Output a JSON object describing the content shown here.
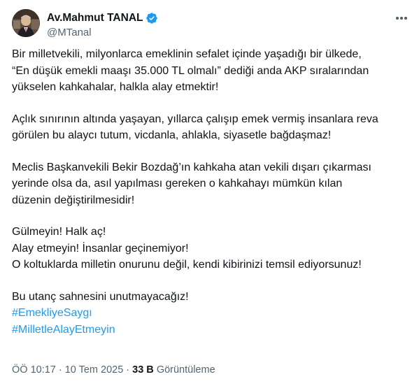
{
  "author": {
    "display_name": "Av.Mahmut TANAL",
    "handle": "@MTanal",
    "verified": true,
    "verified_color": "#1d9bf0"
  },
  "tweet": {
    "paragraphs": [
      [
        "Bir milletvekili, milyonlarca emeklinin sefalet içinde yaşadığı bir ülkede,",
        "“En düşük emekli maaşı 35.000 TL olmalı” dediği anda AKP sıralarından",
        "yükselen kahkahalar, halkla alay etmektir!"
      ],
      [
        "Açlık sınırının altında yaşayan, yıllarca çalışıp emek vermiş insanlara reva",
        "görülen bu alaycı tutum, vicdanla, ahlakla, siyasetle bağdaşmaz!"
      ],
      [
        "Meclis Başkanvekili Bekir Bozdağ’ın kahkaha atan vekili dışarı çıkarması",
        "yerinde olsa da, asıl yapılması gereken o kahkahayı mümkün kılan",
        "düzenin değiştirilmesidir!"
      ],
      [
        "Gülmeyin! Halk aç!",
        "Alay etmeyin! İnsanlar geçinemiyor!",
        "O koltuklarda milletin onurunu değil, kendi kibirinizi temsil ediyorsunuz!"
      ]
    ],
    "closing_line": "Bu utanç sahnesini unutmayacağız!",
    "hashtags": [
      "#EmekliyeSaygı",
      "#MilletleAlayEtmeyin"
    ],
    "hashtag_color": "#1d9bf0"
  },
  "meta": {
    "time": "ÖÖ 10:17",
    "separator": "·",
    "date": "10 Tem 2025",
    "views_count": "33 B",
    "views_label": "Görüntüleme"
  },
  "icons": {
    "avatar": "profile-photo",
    "verified": "verified-badge-icon",
    "more": "more-options-icon"
  }
}
